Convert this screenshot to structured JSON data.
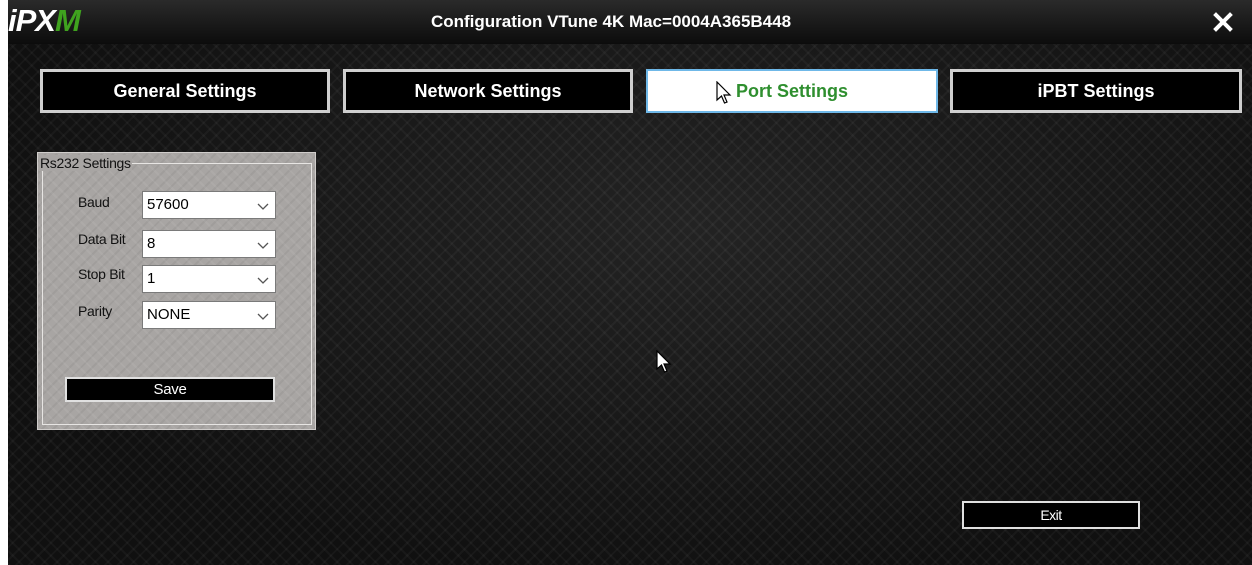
{
  "app": {
    "logo_left": "iPX",
    "logo_right": "M",
    "title": "Configuration VTune 4K Mac=0004A365B448"
  },
  "tabs": [
    {
      "label": "General Settings",
      "active": false
    },
    {
      "label": "Network Settings",
      "active": false
    },
    {
      "label": "Port Settings",
      "active": true
    },
    {
      "label": "iPBT Settings",
      "active": false
    }
  ],
  "rs232": {
    "legend": "Rs232 Settings",
    "fields": [
      {
        "label": "Baud",
        "value": "57600"
      },
      {
        "label": "Data Bit",
        "value": "8"
      },
      {
        "label": "Stop Bit",
        "value": "1"
      },
      {
        "label": "Parity",
        "value": "NONE"
      }
    ],
    "save_label": "Save"
  },
  "footer": {
    "exit_label": "Exit"
  },
  "icons": {
    "close": "close-icon",
    "dropdown": "chevron-down-icon",
    "cursor": "arrow-cursor-icon"
  },
  "colors": {
    "background": "#121212",
    "logo_green": "#3fa21e",
    "active_tab_text": "#2f8f2f",
    "active_tab_border": "#6fb8e8",
    "panel": "#a8a5a3"
  }
}
